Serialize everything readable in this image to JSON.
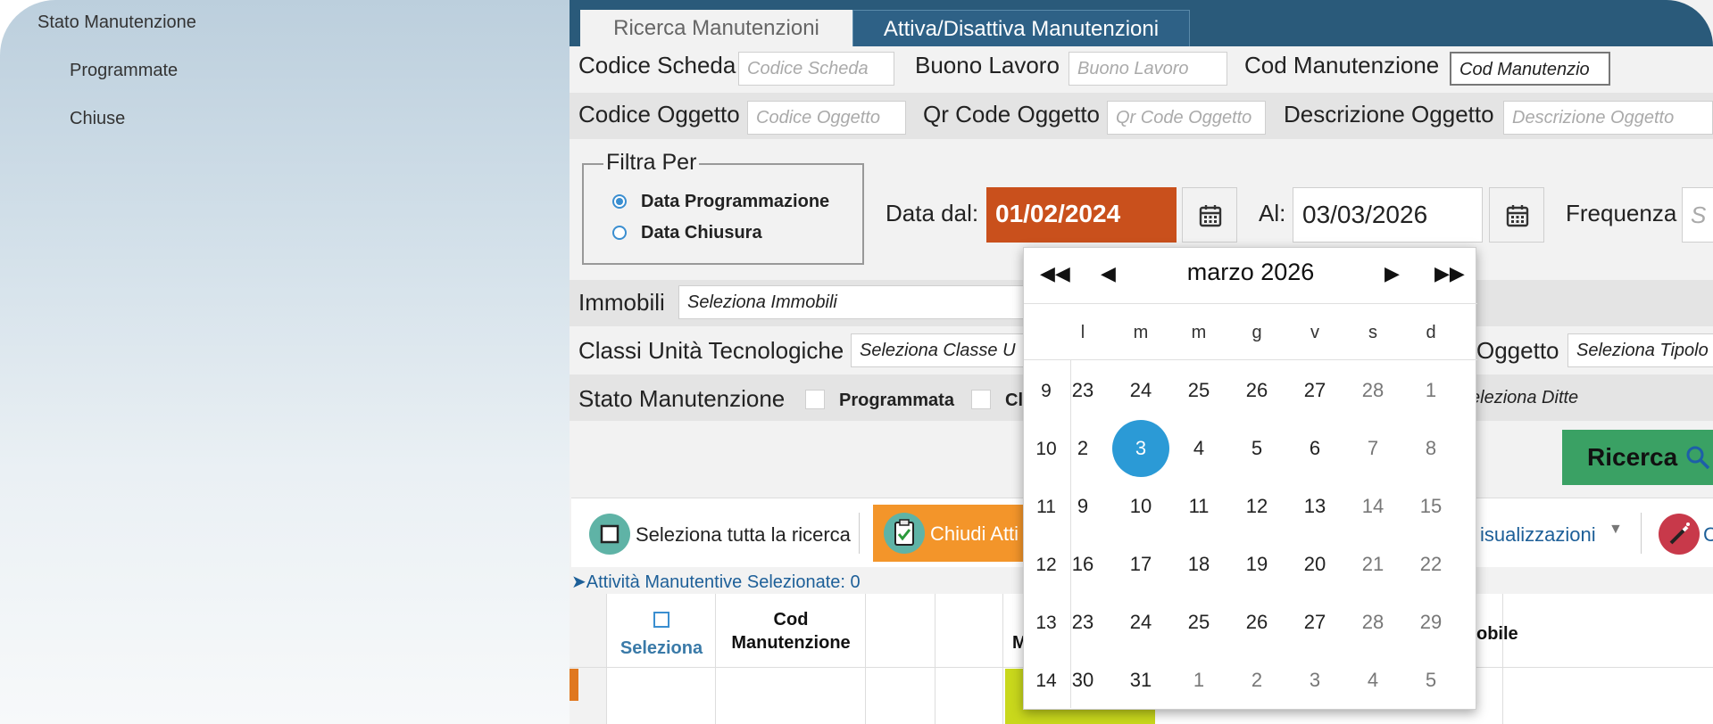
{
  "sidebar": {
    "title": "Stato Manutenzione",
    "items": [
      {
        "label": "Programmate"
      },
      {
        "label": "Chiuse"
      }
    ]
  },
  "tabs": [
    {
      "label": "Ricerca Manutenzioni",
      "active": false
    },
    {
      "label": "Attiva/Disattiva Manutenzioni",
      "active": true
    }
  ],
  "form": {
    "codice_scheda": {
      "label": "Codice Scheda",
      "placeholder": "Codice Scheda"
    },
    "buono_lavoro": {
      "label": "Buono Lavoro",
      "placeholder": "Buono Lavoro"
    },
    "cod_manutenzione": {
      "label": "Cod Manutenzione",
      "placeholder": "Cod Manutenzio"
    },
    "codice_oggetto": {
      "label": "Codice Oggetto",
      "placeholder": "Codice Oggetto"
    },
    "qr_code": {
      "label": "Qr Code Oggetto",
      "placeholder": "Qr Code Oggetto"
    },
    "descrizione_oggetto": {
      "label": "Descrizione Oggetto",
      "placeholder": "Descrizione Oggetto"
    },
    "filtra_per": {
      "legend": "Filtra Per",
      "options": [
        {
          "label": "Data Programmazione",
          "selected": true
        },
        {
          "label": "Data Chiusura",
          "selected": false
        }
      ]
    },
    "data_dal": {
      "label": "Data dal:",
      "value": "01/02/2024"
    },
    "al": {
      "label": "Al:",
      "value": "03/03/2026"
    },
    "frequenza": {
      "label": "Frequenza",
      "placeholder": "S"
    },
    "immobili": {
      "label": "Immobili",
      "placeholder": "Seleziona Immobili"
    },
    "classi": {
      "label": "Classi Unità Tecnologiche",
      "placeholder": "Seleziona Classe U"
    },
    "tipologia_oggetto": {
      "label": "Oggetto",
      "placeholder": "Seleziona Tipolo"
    },
    "stato_manutenzione": {
      "label": "Stato Manutenzione",
      "options": [
        {
          "label": "Programmata"
        },
        {
          "label": "Cl"
        }
      ]
    },
    "ditte": {
      "placeholder": "eleziona Ditte"
    },
    "ricerca_button": "Ricerca"
  },
  "toolbar": {
    "select_all": "Seleziona tutta la ricerca",
    "chiudi": "Chiudi Atti",
    "visualizzazioni": "isualizzazioni",
    "last": "C"
  },
  "selected_info": "Attività Manutentive Selezionate: 0",
  "grid": {
    "headers": {
      "seleziona": "Seleziona",
      "cod_line1": "Cod",
      "cod_line2": "Manutenzione",
      "m": "M",
      "immobile": "obile"
    }
  },
  "datepicker": {
    "title": "marzo 2026",
    "weekday_headers": [
      "l",
      "m",
      "m",
      "g",
      "v",
      "s",
      "d"
    ],
    "weeks": [
      {
        "num": "9",
        "days": [
          "23",
          "24",
          "25",
          "26",
          "27",
          "28",
          "1"
        ],
        "muted": [
          false,
          false,
          false,
          false,
          false,
          true,
          true
        ]
      },
      {
        "num": "10",
        "days": [
          "2",
          "3",
          "4",
          "5",
          "6",
          "7",
          "8"
        ],
        "muted": [
          false,
          false,
          false,
          false,
          false,
          true,
          true
        ]
      },
      {
        "num": "11",
        "days": [
          "9",
          "10",
          "11",
          "12",
          "13",
          "14",
          "15"
        ],
        "muted": [
          false,
          false,
          false,
          false,
          false,
          true,
          true
        ]
      },
      {
        "num": "12",
        "days": [
          "16",
          "17",
          "18",
          "19",
          "20",
          "21",
          "22"
        ],
        "muted": [
          false,
          false,
          false,
          false,
          false,
          true,
          true
        ]
      },
      {
        "num": "13",
        "days": [
          "23",
          "24",
          "25",
          "26",
          "27",
          "28",
          "29"
        ],
        "muted": [
          false,
          false,
          false,
          false,
          false,
          true,
          true
        ]
      },
      {
        "num": "14",
        "days": [
          "30",
          "31",
          "1",
          "2",
          "3",
          "4",
          "5"
        ],
        "muted": [
          false,
          false,
          true,
          true,
          true,
          true,
          true
        ]
      }
    ],
    "selected_day": "3"
  },
  "colors": {
    "header_bar": "#2a5a7a",
    "active_tab": "#2e6186",
    "date_from_bg": "#c9501c",
    "ricerca_green": "#3aa164",
    "chiudi_orange": "#f3952a",
    "selected_day": "#2b9ad6"
  },
  "icons": [
    "calendar-icon",
    "magnifier-icon",
    "checkbox-icon",
    "clipboard-check-icon",
    "magic-wand-icon",
    "caret-down-icon"
  ]
}
